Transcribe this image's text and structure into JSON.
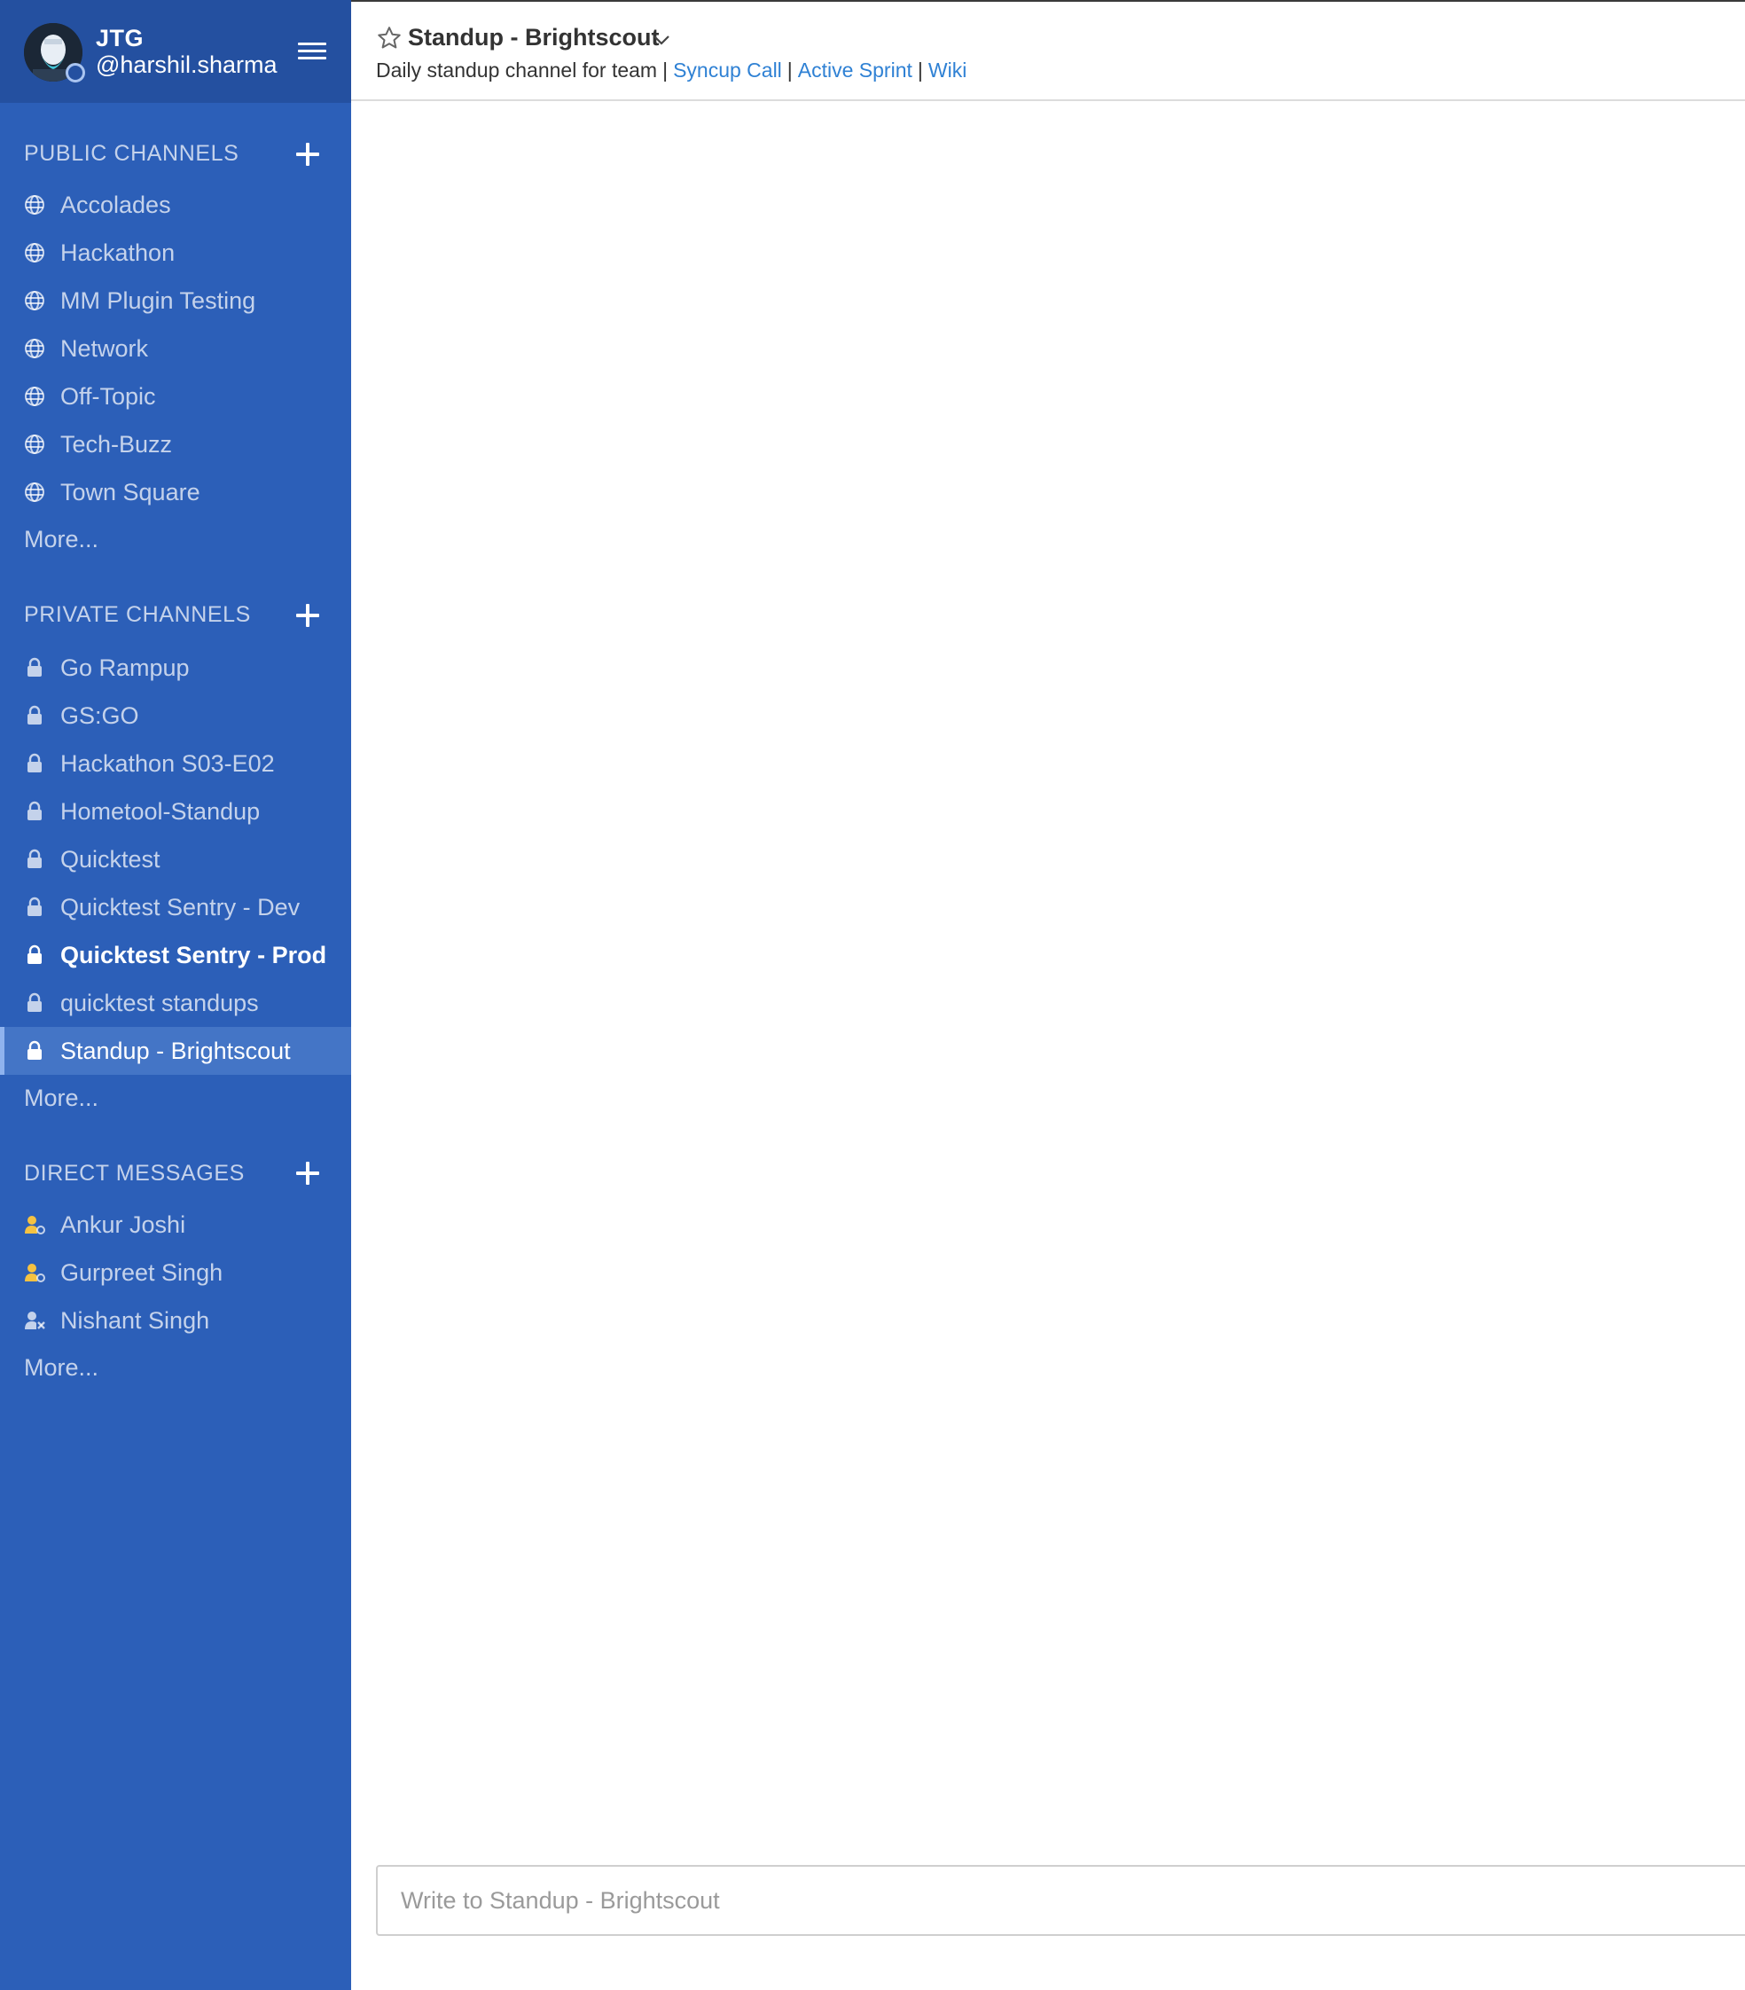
{
  "header": {
    "team_name": "JTG",
    "username": "@harshil.sharma"
  },
  "sidebar": {
    "public": {
      "title": "PUBLIC CHANNELS",
      "items": [
        {
          "label": "Accolades"
        },
        {
          "label": "Hackathon"
        },
        {
          "label": "MM Plugin Testing"
        },
        {
          "label": "Network"
        },
        {
          "label": "Off-Topic"
        },
        {
          "label": "Tech-Buzz"
        },
        {
          "label": "Town Square"
        }
      ],
      "more": "More..."
    },
    "private": {
      "title": "PRIVATE CHANNELS",
      "items": [
        {
          "label": "Go Rampup"
        },
        {
          "label": "GS:GO"
        },
        {
          "label": "Hackathon S03-E02"
        },
        {
          "label": "Hometool-Standup"
        },
        {
          "label": "Quicktest"
        },
        {
          "label": "Quicktest Sentry - Dev"
        },
        {
          "label": "Quicktest Sentry - Prod",
          "unread": true
        },
        {
          "label": "quicktest standups"
        },
        {
          "label": "Standup - Brightscout",
          "active": true
        }
      ],
      "more": "More..."
    },
    "direct": {
      "title": "DIRECT MESSAGES",
      "items": [
        {
          "label": "Ankur Joshi",
          "status": "away"
        },
        {
          "label": "Gurpreet Singh",
          "status": "away"
        },
        {
          "label": "Nishant Singh",
          "status": "offline"
        }
      ],
      "more": "More..."
    }
  },
  "channel": {
    "name": "Standup - Brightscout",
    "purpose": "Daily standup channel for team",
    "separator": "|",
    "links": [
      "Syncup Call",
      "Active Sprint",
      "Wiki"
    ]
  },
  "composer": {
    "placeholder": "Write to Standup - Brightscout"
  },
  "colors": {
    "sidebar_bg": "#2c5fb8",
    "sidebar_header_bg": "#2450a0",
    "active_item_bg": "#4475c6",
    "link": "#2f81d4",
    "away_status": "#f5c242"
  },
  "icons": {
    "public_channel": "globe-icon",
    "private_channel": "lock-icon",
    "dm_away": "user-away-icon",
    "dm_offline": "user-offline-icon",
    "favorite": "star-outline-icon",
    "dropdown": "chevron-down-icon",
    "menu": "hamburger-menu-icon"
  }
}
